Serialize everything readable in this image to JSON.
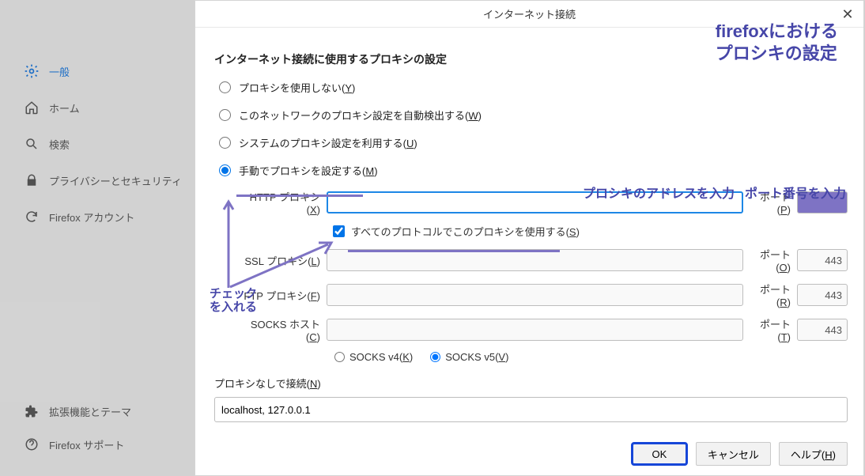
{
  "sidebar": {
    "items": [
      {
        "label": "一般",
        "icon": "gear"
      },
      {
        "label": "ホーム",
        "icon": "home"
      },
      {
        "label": "検索",
        "icon": "search"
      },
      {
        "label": "プライバシーとセキュリティ",
        "icon": "lock"
      },
      {
        "label": "Firefox アカウント",
        "icon": "sync"
      }
    ],
    "bottom": [
      {
        "label": "拡張機能とテーマ",
        "icon": "puzzle"
      },
      {
        "label": "Firefox サポート",
        "icon": "help"
      }
    ]
  },
  "dialog": {
    "title": "インターネット接続",
    "section_title": "インターネット接続に使用するプロキシの設定",
    "radios": {
      "no_proxy": "プロキシを使用しない",
      "no_proxy_ak": "Y",
      "auto": "このネットワークのプロキシ設定を自動検出する",
      "auto_ak": "W",
      "system": "システムのプロキシ設定を利用する",
      "system_ak": "U",
      "manual": "手動でプロキシを設定する",
      "manual_ak": "M"
    },
    "labels": {
      "http": "HTTP プロキシ",
      "http_ak": "X",
      "port": "ポート",
      "port_ak_p": "P",
      "port_ak_o": "O",
      "port_ak_r": "R",
      "port_ak_t": "T",
      "share": "すべてのプロトコルでこのプロキシを使用する",
      "share_ak": "S",
      "ssl": "SSL プロキシ",
      "ssl_ak": "L",
      "ftp": "FTP プロキシ",
      "ftp_ak": "F",
      "socks": "SOCKS ホスト",
      "socks_ak": "C",
      "socks4": "SOCKS v4",
      "socks4_ak": "K",
      "socks5": "SOCKS v5",
      "socks5_ak": "V",
      "noproxy": "プロキシなしで接続",
      "noproxy_ak": "N"
    },
    "values": {
      "http": "",
      "http_port": "",
      "ssl": "",
      "ssl_port": "443",
      "ftp": "",
      "ftp_port": "443",
      "socks": "",
      "socks_port": "443",
      "noproxy": "localhost, 127.0.0.1",
      "socks_ver": "v5",
      "share_checked": true,
      "selected_radio": "manual"
    },
    "buttons": {
      "ok": "OK",
      "cancel": "キャンセル",
      "help": "ヘルプ",
      "help_ak": "H"
    }
  },
  "annotations": {
    "title1": "firefoxにおける",
    "title2": "プロシキの設定",
    "addr": "プロシキのアドレスを入力",
    "port": "ポート番号を入力",
    "check1": "チェック",
    "check2": "を入れる"
  }
}
